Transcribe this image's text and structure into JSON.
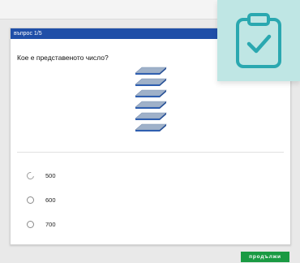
{
  "quiz": {
    "progress_label": "въпрос 1/5",
    "question": "Кое е представеното число?",
    "plates_shown": 6,
    "options": [
      {
        "label": "500",
        "selected": false
      },
      {
        "label": "600",
        "selected": false
      },
      {
        "label": "700",
        "selected": false
      }
    ],
    "continue_label": "продължи"
  },
  "icons": {
    "badge": "clipboard-check-icon"
  },
  "colors": {
    "header": "#1f4fa8",
    "continue_button": "#1a9a43",
    "badge_background": "#bfe6e4",
    "badge_icon": "#2aa8b0",
    "plate_top": "#9fb1c9",
    "plate_edge": "#2f5fb0"
  }
}
